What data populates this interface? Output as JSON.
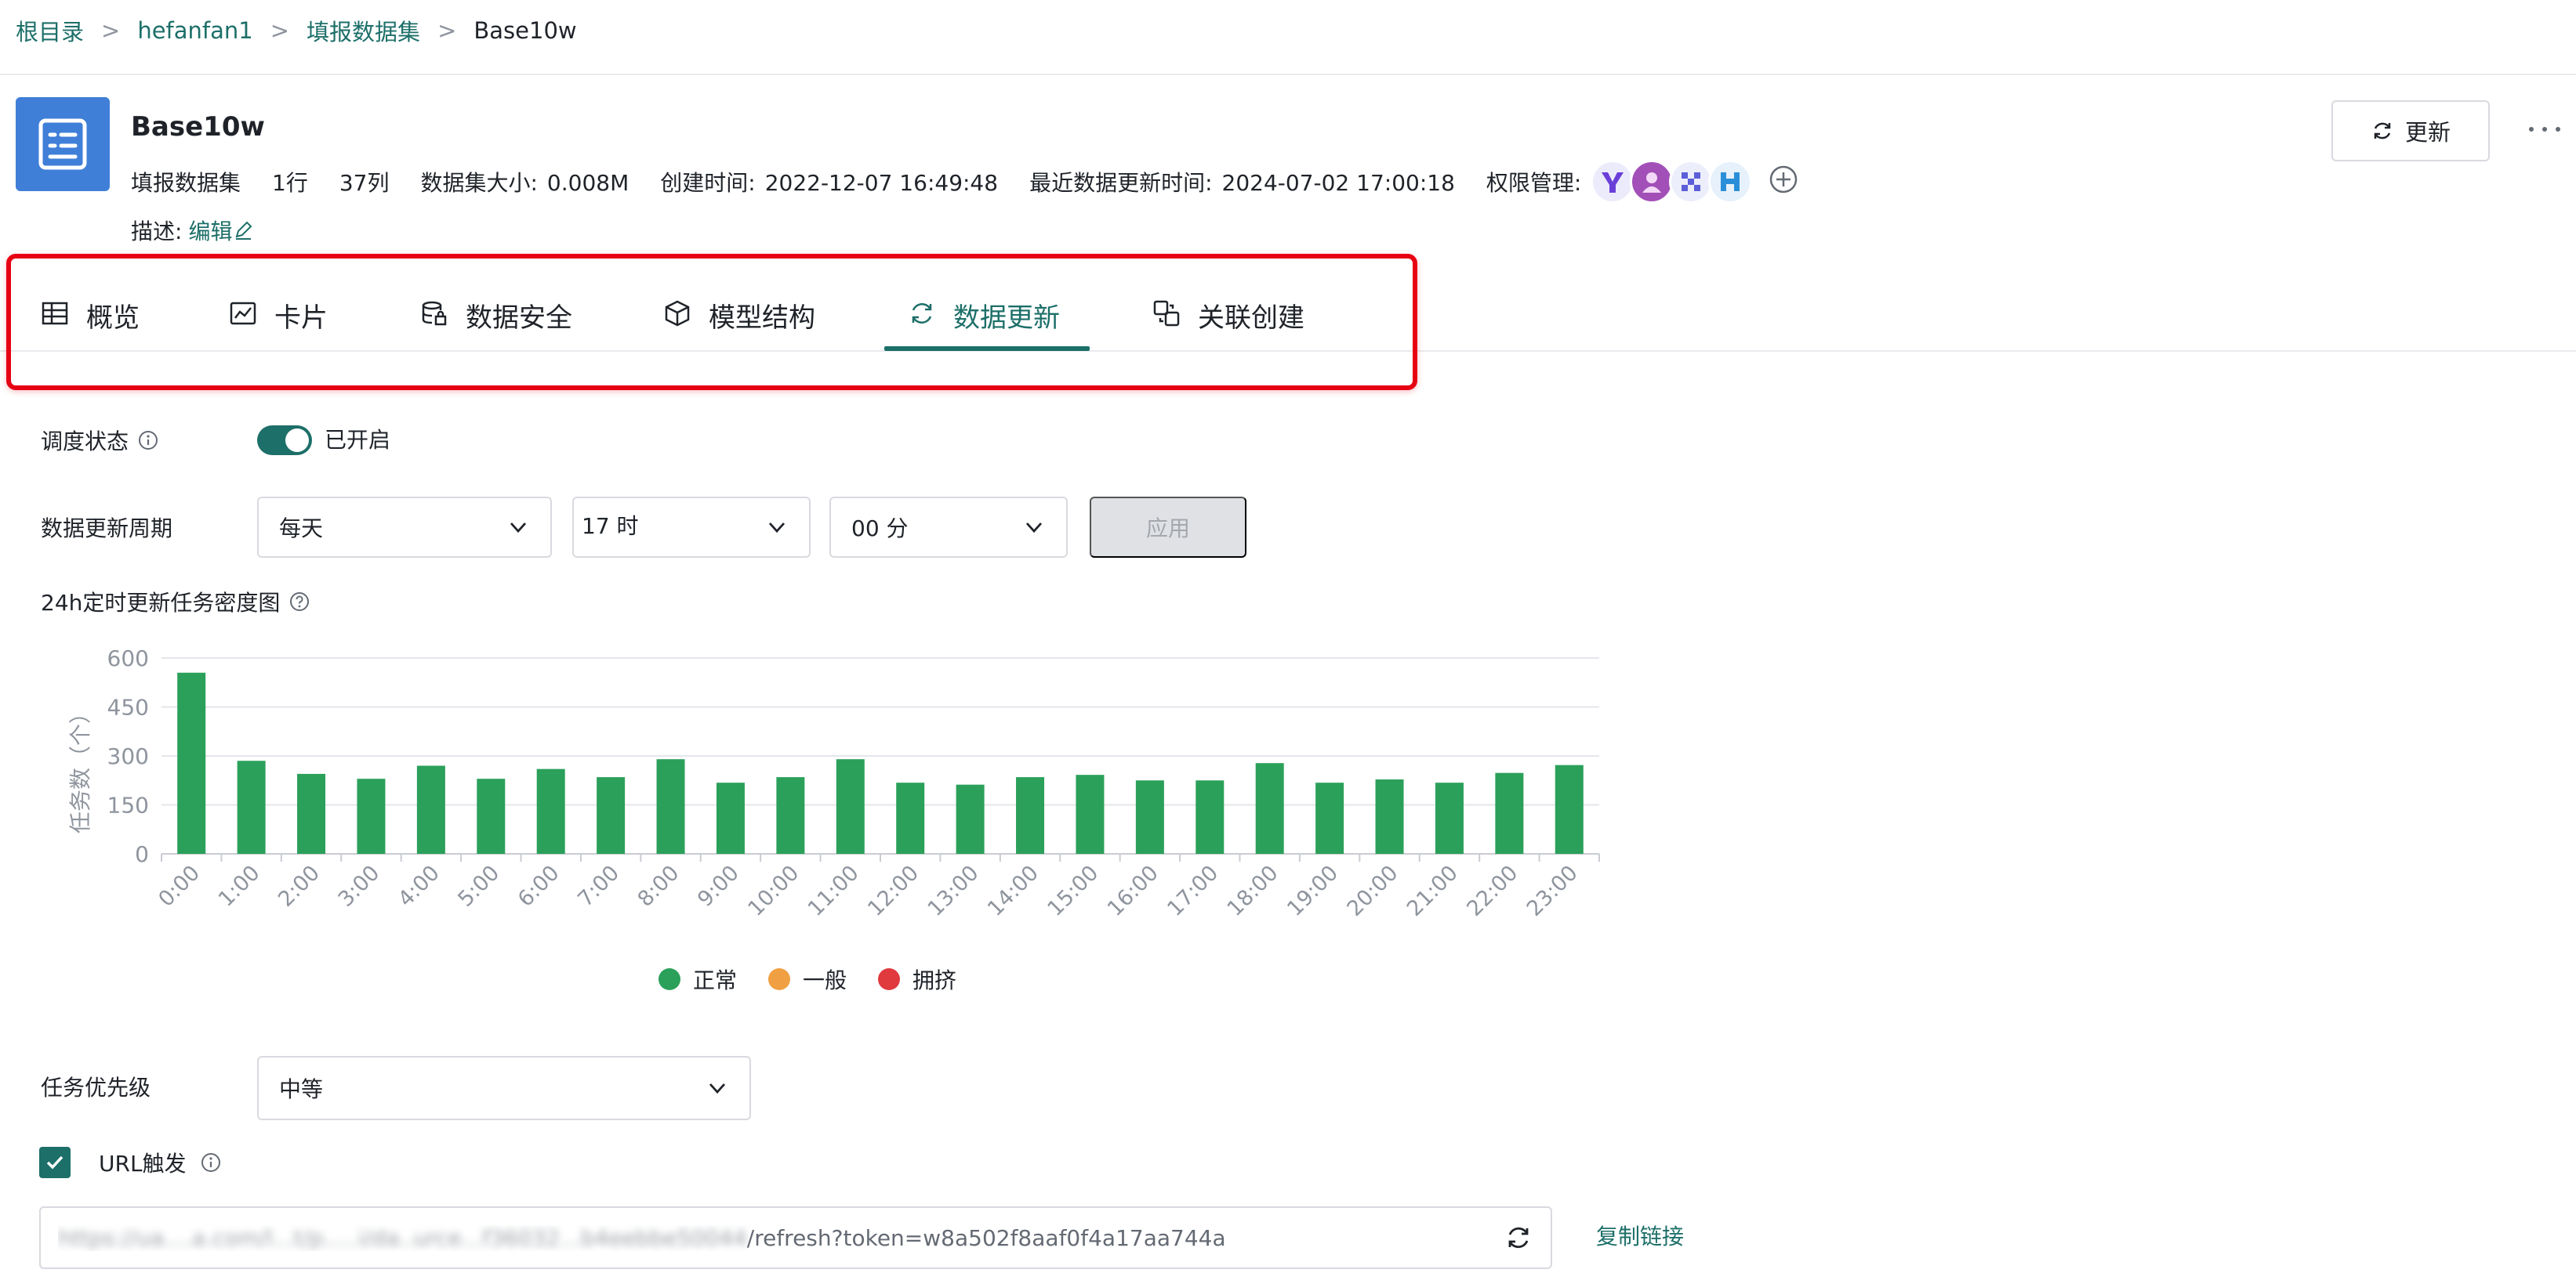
{
  "breadcrumb": {
    "items": [
      "根目录",
      "hefanfan1",
      "填报数据集"
    ],
    "current": "Base10w",
    "separator": ">"
  },
  "header": {
    "title": "Base10w",
    "type": "填报数据集",
    "rows": "1行",
    "cols": "37列",
    "size_label": "数据集大小:",
    "size_value": "0.008M",
    "created_label": "创建时间:",
    "created_value": "2022-12-07 16:49:48",
    "updated_label": "最近数据更新时间:",
    "updated_value": "2024-07-02 17:00:18",
    "perm_label": "权限管理:",
    "desc_label": "描述:",
    "edit_label": "编辑",
    "update_button": "更新"
  },
  "tabs": [
    {
      "label": "概览",
      "icon": "table-icon"
    },
    {
      "label": "卡片",
      "icon": "line-chart-icon"
    },
    {
      "label": "数据安全",
      "icon": "database-lock-icon"
    },
    {
      "label": "模型结构",
      "icon": "cube-icon"
    },
    {
      "label": "数据更新",
      "icon": "refresh-icon",
      "active": true
    },
    {
      "label": "关联创建",
      "icon": "link-create-icon"
    }
  ],
  "schedule": {
    "status_label": "调度状态",
    "status_text": "已开启",
    "enabled": true,
    "period_label": "数据更新周期",
    "period_value": "每天",
    "hour_value": "17 时",
    "minute_value": "00 分",
    "apply_label": "应用"
  },
  "chart_title": "24h定时更新任务密度图",
  "chart_data": {
    "type": "bar",
    "categories": [
      "0:00",
      "1:00",
      "2:00",
      "3:00",
      "4:00",
      "5:00",
      "6:00",
      "7:00",
      "8:00",
      "9:00",
      "10:00",
      "11:00",
      "12:00",
      "13:00",
      "14:00",
      "15:00",
      "16:00",
      "17:00",
      "18:00",
      "19:00",
      "20:00",
      "21:00",
      "22:00",
      "23:00"
    ],
    "values": [
      555,
      285,
      245,
      230,
      270,
      230,
      260,
      235,
      290,
      218,
      235,
      290,
      218,
      212,
      235,
      242,
      225,
      225,
      278,
      218,
      228,
      218,
      248,
      272
    ],
    "ylabel": "任务数（个）",
    "yticks": [
      0,
      150,
      300,
      450,
      600
    ],
    "ylim": [
      0,
      600
    ],
    "grid": true,
    "legend": [
      {
        "name": "正常",
        "color": "#2ba05a"
      },
      {
        "name": "一般",
        "color": "#f0a042"
      },
      {
        "name": "拥挤",
        "color": "#e0393e"
      }
    ],
    "legend_position": "bottom",
    "bar_color": "#2ba05a"
  },
  "priority": {
    "label": "任务优先级",
    "value": "中等"
  },
  "url_trigger": {
    "label": "URL触发",
    "checked": true,
    "url_visible": "/refresh?token=w8a502f8aaf0f4a17aa744a",
    "url_blurred": "https://ua....a.com/l...t/p.....i/da..urce...f36032...b4eebbe50044",
    "copy_label": "复制链接"
  },
  "colors": {
    "accent": "#1d6f69",
    "highlight": "#e60012"
  }
}
